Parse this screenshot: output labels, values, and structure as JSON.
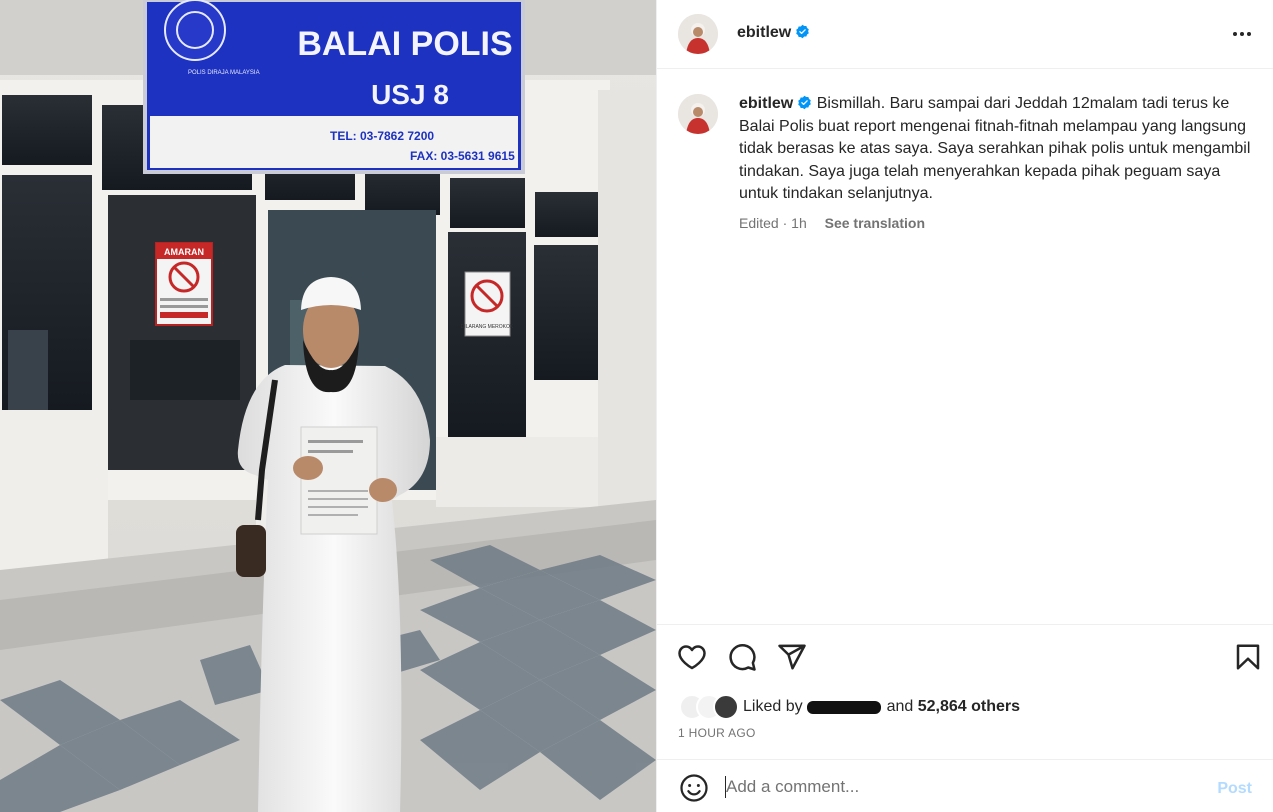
{
  "photo": {
    "alt_icon": "photo",
    "sign": {
      "title": "BALAI POLIS",
      "subtitle": "USJ 8",
      "phone": "TEL: 03-7862 7200",
      "fax": "FAX: 03-5631 9615",
      "crest_text": "POLIS DIRAJA MALAYSIA"
    },
    "warning_sign": {
      "title": "AMARAN"
    },
    "no_smoking_sign": {
      "caption": "DILARANG MEROKOK"
    }
  },
  "post": {
    "username": "ebitlew",
    "verified": true,
    "caption": "Bismillah. Baru sampai dari Jeddah 12malam tadi terus ke Balai Polis buat report mengenai fitnah-fitnah melampau yang langsung tidak berasas ke atas saya. Saya serahkan pihak polis untuk mengambil tindakan. Saya juga telah menyerahkan kepada pihak peguam saya untuk tindakan selanjutnya.",
    "edited_label": "Edited",
    "separator": "·",
    "time_short": "1h",
    "see_translation": "See translation",
    "likes": {
      "prefix": "Liked by",
      "connector": "and",
      "others": "52,864 others"
    },
    "time_long": "1 HOUR AGO"
  },
  "comment": {
    "placeholder": "Add a comment...",
    "post_label": "Post"
  },
  "colors": {
    "verified": "#0095f6",
    "post_button": "#b3dbff",
    "sign_blue": "#1b2fb5"
  },
  "icons": [
    "heart-icon",
    "comment-icon",
    "share-icon",
    "bookmark-icon",
    "emoji-icon",
    "more-icon",
    "verified-icon"
  ]
}
